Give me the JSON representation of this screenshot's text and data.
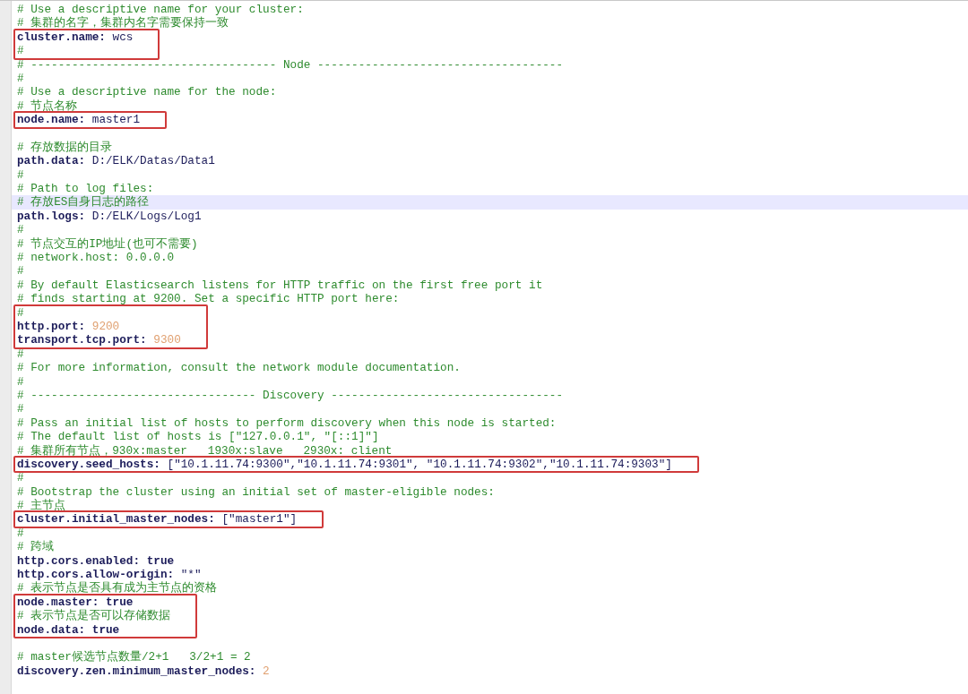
{
  "editor": {
    "blocks": [
      {
        "boxed": false,
        "lines": [
          {
            "kind": "comment",
            "text": "# Use a descriptive name for your cluster:",
            "current": false
          },
          {
            "kind": "comment",
            "text": "# 集群的名字，集群内名字需要保持一致",
            "current": false
          }
        ]
      },
      {
        "boxed": true,
        "lines": [
          {
            "kind": "setting",
            "key": "cluster.name:",
            "value": "wcs",
            "current": false
          },
          {
            "kind": "comment",
            "text": "#",
            "current": false
          }
        ]
      },
      {
        "boxed": false,
        "lines": [
          {
            "kind": "comment",
            "text": "# ------------------------------------ Node ------------------------------------",
            "current": false
          },
          {
            "kind": "comment",
            "text": "#",
            "current": false
          },
          {
            "kind": "comment",
            "text": "# Use a descriptive name for the node:",
            "current": false
          },
          {
            "kind": "comment",
            "text": "# 节点名称",
            "current": false
          }
        ]
      },
      {
        "boxed": true,
        "lines": [
          {
            "kind": "setting",
            "key": "node.name:",
            "value": "master1",
            "current": false
          }
        ]
      },
      {
        "boxed": false,
        "lines": [
          {
            "kind": "blank",
            "current": false
          },
          {
            "kind": "comment",
            "text": "# 存放数据的目录",
            "current": false
          },
          {
            "kind": "setting",
            "key": "path.data:",
            "value": "D:/ELK/Datas/Data1",
            "current": false
          },
          {
            "kind": "comment",
            "text": "#",
            "current": false
          },
          {
            "kind": "comment",
            "text": "# Path to log files:",
            "current": false
          },
          {
            "kind": "comment",
            "text": "# 存放ES自身日志的路径",
            "current": true
          },
          {
            "kind": "setting",
            "key": "path.logs:",
            "value": "D:/ELK/Logs/Log1",
            "current": false
          },
          {
            "kind": "comment",
            "text": "#",
            "current": false
          },
          {
            "kind": "comment",
            "text": "# 节点交互的IP地址(也可不需要)",
            "current": false
          },
          {
            "kind": "comment",
            "text": "# network.host: 0.0.0.0",
            "current": false
          },
          {
            "kind": "comment",
            "text": "#",
            "current": false
          },
          {
            "kind": "comment",
            "text": "# By default Elasticsearch listens for HTTP traffic on the first free port it",
            "current": false
          },
          {
            "kind": "comment",
            "text": "# finds starting at 9200. Set a specific HTTP port here:",
            "current": false
          }
        ]
      },
      {
        "boxed": true,
        "lines": [
          {
            "kind": "comment",
            "text": "#",
            "current": false
          },
          {
            "kind": "numeric",
            "key": "http.port:",
            "value": "9200",
            "current": false
          },
          {
            "kind": "numeric",
            "key": "transport.tcp.port:",
            "value": "9300",
            "current": false
          }
        ]
      },
      {
        "boxed": false,
        "lines": [
          {
            "kind": "comment",
            "text": "#",
            "current": false
          },
          {
            "kind": "comment",
            "text": "# For more information, consult the network module documentation.",
            "current": false
          },
          {
            "kind": "comment",
            "text": "#",
            "current": false
          },
          {
            "kind": "comment",
            "text": "# --------------------------------- Discovery ----------------------------------",
            "current": false
          },
          {
            "kind": "comment",
            "text": "#",
            "current": false
          },
          {
            "kind": "comment",
            "text": "# Pass an initial list of hosts to perform discovery when this node is started:",
            "current": false
          },
          {
            "kind": "comment",
            "text": "# The default list of hosts is [\"127.0.0.1\", \"[::1]\"]",
            "current": false
          },
          {
            "kind": "comment",
            "text": "# 集群所有节点，930x:master   1930x:slave   2930x: client",
            "current": false
          }
        ]
      },
      {
        "boxed": true,
        "lines": [
          {
            "kind": "setting",
            "key": "discovery.seed_hosts:",
            "value": "[\"10.1.11.74:9300\",\"10.1.11.74:9301\", \"10.1.11.74:9302\",\"10.1.11.74:9303\"]",
            "current": false
          }
        ]
      },
      {
        "boxed": false,
        "lines": [
          {
            "kind": "comment",
            "text": "#",
            "current": false
          },
          {
            "kind": "comment",
            "text": "# Bootstrap the cluster using an initial set of master-eligible nodes:",
            "current": false
          },
          {
            "kind": "comment",
            "text": "# 主节点",
            "current": false
          }
        ]
      },
      {
        "boxed": true,
        "lines": [
          {
            "kind": "setting",
            "key": "cluster.initial_master_nodes:",
            "value": "[\"master1\"]",
            "current": false
          }
        ]
      },
      {
        "boxed": false,
        "lines": [
          {
            "kind": "comment",
            "text": "#",
            "current": false
          },
          {
            "kind": "comment",
            "text": "# 跨域",
            "current": false
          },
          {
            "kind": "flag",
            "key": "http.cors.enabled:",
            "value": "true",
            "current": false
          },
          {
            "kind": "setting",
            "key": "http.cors.allow-origin:",
            "value": "\"*\"",
            "current": false
          },
          {
            "kind": "comment",
            "text": "# 表示节点是否具有成为主节点的资格",
            "current": false
          }
        ]
      },
      {
        "boxed": true,
        "lines": [
          {
            "kind": "flag",
            "key": "node.master:",
            "value": "true",
            "current": false
          },
          {
            "kind": "comment",
            "text": "# 表示节点是否可以存储数据",
            "current": false
          },
          {
            "kind": "flag",
            "key": "node.data:",
            "value": "true",
            "current": false
          }
        ]
      },
      {
        "boxed": false,
        "lines": [
          {
            "kind": "blank",
            "current": false
          },
          {
            "kind": "comment",
            "text": "# master候选节点数量/2+1   3/2+1 = 2",
            "current": false
          },
          {
            "kind": "numeric",
            "key": "discovery.zen.minimum_master_nodes:",
            "value": "2",
            "current": false
          }
        ]
      }
    ]
  }
}
